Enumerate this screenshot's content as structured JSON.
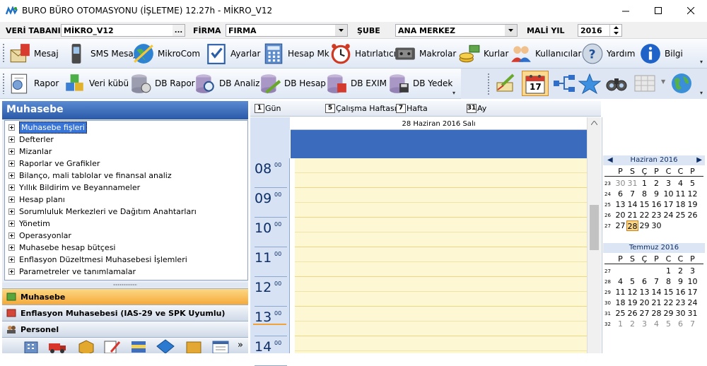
{
  "window": {
    "title": "BURO BÜRO OTOMASYONU (İŞLETME) 12.27h - MİKRO_V12",
    "minimize_glyph": "—",
    "maximize_glyph": "☐",
    "close_glyph": "✕"
  },
  "dbbar": {
    "database_label": "VERİ TABANI",
    "database_value": "MİKRO_V12",
    "database_button": "...",
    "company_label": "FİRMA",
    "company_value": "FIRMA",
    "branch_label": "ŞUBE",
    "branch_value": "ANA MERKEZ",
    "fiscal_year_label": "MALİ YIL",
    "fiscal_year_value": "2016"
  },
  "toolbar1": [
    {
      "label": "Mesaj",
      "icon": "message-icon"
    },
    {
      "label": "SMS Mesaj",
      "icon": "phone-icon"
    },
    {
      "label": "MikroCom",
      "icon": "mikrocom-icon"
    },
    {
      "label": "Ayarlar",
      "icon": "settings-check-icon"
    },
    {
      "label": "Hesap Mk",
      "icon": "calculator-icon"
    },
    {
      "label": "Hatırlatıcı",
      "icon": "alarm-clock-icon"
    },
    {
      "label": "Makrolar",
      "icon": "macro-icon"
    },
    {
      "label": "Kurlar",
      "icon": "coins-icon"
    },
    {
      "label": "Kullanıcılar",
      "icon": "users-icon"
    },
    {
      "label": "Yardım",
      "icon": "help-icon"
    },
    {
      "label": "Bilgi",
      "icon": "info-icon"
    }
  ],
  "toolbar2": [
    {
      "label": "Rapor",
      "icon": "report-icon"
    },
    {
      "label": "Veri kübü",
      "icon": "data-cube-icon"
    },
    {
      "label": "DB Rapor",
      "icon": "db-report-icon"
    },
    {
      "label": "DB Analiz",
      "icon": "db-analysis-icon"
    },
    {
      "label": "DB Hesap",
      "icon": "db-calc-icon"
    },
    {
      "label": "DB EXIM",
      "icon": "db-exim-icon"
    },
    {
      "label": "DB Yedek",
      "icon": "db-backup-icon"
    }
  ],
  "toolbar2_right": {
    "calendar_day": "17"
  },
  "leftpanel": {
    "title": "Muhasebe",
    "tree": [
      "Muhasebe fişleri",
      "Defterler",
      "Mizanlar",
      "Raporlar ve Grafikler",
      "Bilanço, mali tablolar ve finansal analiz",
      "Yıllık Bildirim ve Beyannameler",
      "Hesap planı",
      "Sorumluluk Merkezleri ve Dağıtım Anahtarları",
      "Yönetim",
      "Operasyonlar",
      "Muhasebe hesap bütçesi",
      "Enflasyon Düzeltmesi Muhasebesi İşlemleri",
      "Parametreler ve tanımlamalar"
    ],
    "nav": [
      {
        "label": "Muhasebe",
        "state": "active"
      },
      {
        "label": "Enflasyon Muhasebesi (IAS-29 ve SPK Uyumlu)",
        "state": "plain"
      },
      {
        "label": "Personel",
        "state": "plain"
      }
    ],
    "more_glyph": "»"
  },
  "calendar": {
    "views": [
      {
        "num": "1",
        "label": "Gün"
      },
      {
        "num": "5",
        "label": "Çalışma Haftası"
      },
      {
        "num": "7",
        "label": "Hafta"
      },
      {
        "num": "31",
        "label": "Ay"
      }
    ],
    "day_header": "28 Haziran 2016 Salı",
    "hours": [
      "08",
      "09",
      "10",
      "11",
      "12",
      "13",
      "14"
    ],
    "minutes": "00"
  },
  "minicals": [
    {
      "title": "Haziran 2016",
      "prev": "◀",
      "next": "▶",
      "dow": [
        "P",
        "S",
        "Ç",
        "P",
        "C",
        "C",
        "P"
      ],
      "weeks": [
        {
          "wk": "23",
          "days": [
            "30",
            "31",
            "1",
            "2",
            "3",
            "4",
            "5"
          ],
          "gray": [
            0,
            1
          ]
        },
        {
          "wk": "24",
          "days": [
            "6",
            "7",
            "8",
            "9",
            "10",
            "11",
            "12"
          ],
          "gray": []
        },
        {
          "wk": "25",
          "days": [
            "13",
            "14",
            "15",
            "16",
            "17",
            "18",
            "19"
          ],
          "gray": []
        },
        {
          "wk": "26",
          "days": [
            "20",
            "21",
            "22",
            "23",
            "24",
            "25",
            "26"
          ],
          "gray": []
        },
        {
          "wk": "27",
          "days": [
            "27",
            "28",
            "29",
            "30",
            "",
            "",
            ""
          ],
          "gray": [],
          "today": 1
        }
      ]
    },
    {
      "title": "Temmuz 2016",
      "prev": "",
      "next": "",
      "dow": [
        "P",
        "S",
        "Ç",
        "P",
        "C",
        "C",
        "P"
      ],
      "weeks": [
        {
          "wk": "27",
          "days": [
            "",
            "",
            "",
            "",
            "1",
            "2",
            "3"
          ],
          "gray": []
        },
        {
          "wk": "28",
          "days": [
            "4",
            "5",
            "6",
            "7",
            "8",
            "9",
            "10"
          ],
          "gray": []
        },
        {
          "wk": "29",
          "days": [
            "11",
            "12",
            "13",
            "14",
            "15",
            "16",
            "17"
          ],
          "gray": []
        },
        {
          "wk": "30",
          "days": [
            "18",
            "19",
            "20",
            "21",
            "22",
            "23",
            "24"
          ],
          "gray": []
        },
        {
          "wk": "31",
          "days": [
            "25",
            "26",
            "27",
            "28",
            "29",
            "30",
            "31"
          ],
          "gray": []
        },
        {
          "wk": "32",
          "days": [
            "1",
            "2",
            "3",
            "4",
            "5",
            "6",
            "7"
          ],
          "gray": [
            0,
            1,
            2,
            3,
            4,
            5,
            6
          ]
        }
      ]
    }
  ],
  "colors": {
    "accent": "#3b6bbd",
    "slot_bg": "#fdf7d4",
    "today": "#fbd78a",
    "nav_active": "#f5a93b"
  }
}
